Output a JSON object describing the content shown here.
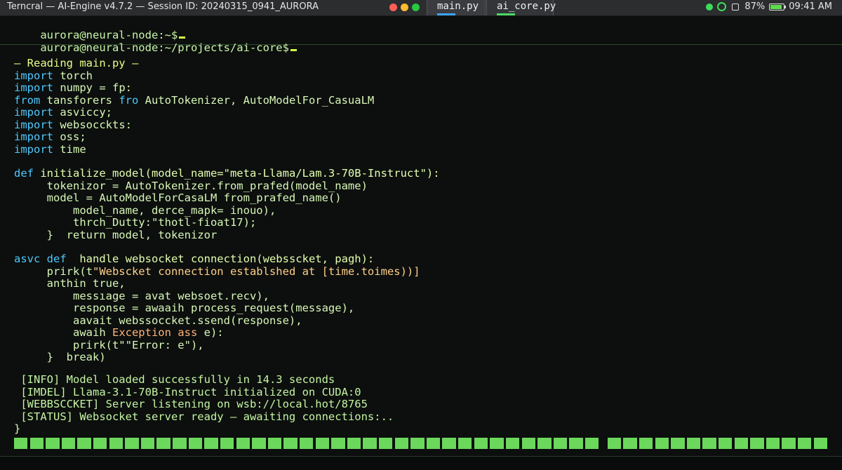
{
  "window": {
    "title": "Terncral — AI-Engine v4.7.2 — Session ID: 20240315_0941_AURORA",
    "tabs": [
      {
        "label": "main.py",
        "active": true
      },
      {
        "label": "ai_core.py",
        "active": false
      }
    ],
    "status": {
      "battery_percent": "87%",
      "time": "09:41 AM"
    }
  },
  "prompts": [
    "aurora@neural-node:~$",
    "aurora@neural-node:~/projects/ai-core$"
  ],
  "code": {
    "header": "— Reading main.py —",
    "imports": [
      {
        "kw": "import",
        "rest": " torch"
      },
      {
        "kw": "import",
        "rest": " numpy = fp:"
      },
      {
        "kw": "from",
        "rest": " tansforers ",
        "kw2": "fro",
        "rest2": " AutoTokenizer, AutoModelFor_CasuaLM"
      },
      {
        "kw": "import",
        "rest": " asviccy;"
      },
      {
        "kw": "import",
        "rest": " websocckts:"
      },
      {
        "kw": "import",
        "rest": " oss;"
      },
      {
        "kw": "import",
        "rest": " time"
      }
    ],
    "def1_kw": "def",
    "def1_sig": " initialize_model(model_name=\"meta-Llama/Lam.3-70B-Instruct\"):",
    "def1_body": [
      "     tokenizor = AutoTokenizer.from_prafed(model_name)",
      "     model = AutoModelForCasaLM from_prafed_name()",
      "         model_name, derce_mapk= inouo),",
      "         thrch_Dutty:\"thotl-fioat17);",
      "     }  return model, tokenizor"
    ],
    "def2_kw1": "asvc",
    "def2_kw2": "def",
    "def2_sig": "  handle websocket connection(websscket, pagh):",
    "def2_line1_pre": "     prirk(t",
    "def2_line1_str": "\"Webscket connection establshed at [time.toimes))]",
    "def2_body": [
      "     anthin true,",
      "         messıage = avat websoet.recv),",
      "         response = awaaih process_request(message),",
      "         aavait webssoccket.ssend(response),"
    ],
    "def2_exc_pre": "         awaih ",
    "def2_exc_kw": "Exception ass",
    "def2_exc_post": " e):",
    "def2_tail": [
      "         prirk(t\"\"Error: e\"),",
      "     }  break)"
    ],
    "logs": [
      " [INFO] Model loaded successfully in 14.3 seconds",
      " [IMDEL] Llama-3.1-70B-Instruct initialized on CUDA:0",
      " [WEBBSCCKET] Server listening on wsb://local.hot/8765",
      " [STATUS] Websocket server ready — awaiting connections:.."
    ],
    "closing": "}"
  },
  "progress": {
    "segments": [
      37,
      51
    ],
    "color": "#6bd85c"
  },
  "colors": {
    "background": "#0c0f0d",
    "keyword": "#4fc8ff",
    "text": "#d8f7b8",
    "string": "#ffcf8a"
  }
}
